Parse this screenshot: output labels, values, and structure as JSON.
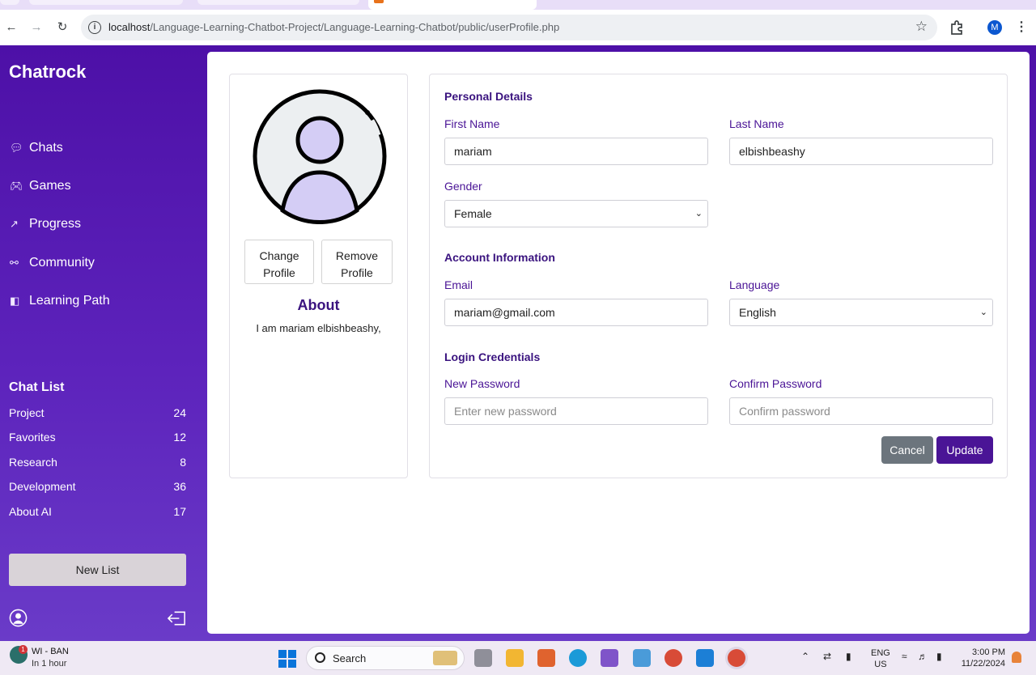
{
  "browser": {
    "url_host": "localhost",
    "url_path": "/Language-Learning-Chatbot-Project/Language-Learning-Chatbot/public/userProfile.php",
    "profile_initial": "M"
  },
  "sidebar": {
    "brand": "Chatrock",
    "nav": [
      {
        "label": "Chats",
        "icon": "chat-icon"
      },
      {
        "label": "Games",
        "icon": "gamepad-icon"
      },
      {
        "label": "Progress",
        "icon": "chart-line-icon"
      },
      {
        "label": "Community",
        "icon": "people-icon"
      },
      {
        "label": "Learning Path",
        "icon": "path-icon"
      }
    ],
    "chat_list_title": "Chat List",
    "chat_list": [
      {
        "label": "Project",
        "count": "24"
      },
      {
        "label": "Favorites",
        "count": "12"
      },
      {
        "label": "Research",
        "count": "8"
      },
      {
        "label": "Development",
        "count": "36"
      },
      {
        "label": "About AI",
        "count": "17"
      }
    ],
    "new_list_label": "New List"
  },
  "profile": {
    "change_label_1": "Change",
    "change_label_2": "Profile",
    "remove_label_1": "Remove",
    "remove_label_2": "Profile",
    "about_title": "About",
    "about_text": "I am mariam elbishbeashy,"
  },
  "form": {
    "personal_title": "Personal Details",
    "first_name_label": "First Name",
    "first_name_value": "mariam",
    "last_name_label": "Last Name",
    "last_name_value": "elbishbeashy",
    "gender_label": "Gender",
    "gender_value": "Female",
    "account_title": "Account Information",
    "email_label": "Email",
    "email_value": "mariam@gmail.com",
    "language_label": "Language",
    "language_value": "English",
    "login_title": "Login Credentials",
    "new_password_label": "New Password",
    "new_password_placeholder": "Enter new password",
    "confirm_password_label": "Confirm Password",
    "confirm_password_placeholder": "Confirm password",
    "cancel_label": "Cancel",
    "update_label": "Update"
  },
  "taskbar": {
    "weather_badge": "1",
    "weather_line1": "WI - BAN",
    "weather_line2": "In 1 hour",
    "search_label": "Search",
    "lang_line1": "ENG",
    "lang_line2": "US",
    "time": "3:00 PM",
    "date": "11/22/2024"
  },
  "colors": {
    "accent": "#4a1496",
    "sidebar_top": "#4d10a7",
    "sidebar_bottom": "#6a3bc8",
    "cancel": "#6c757d"
  }
}
